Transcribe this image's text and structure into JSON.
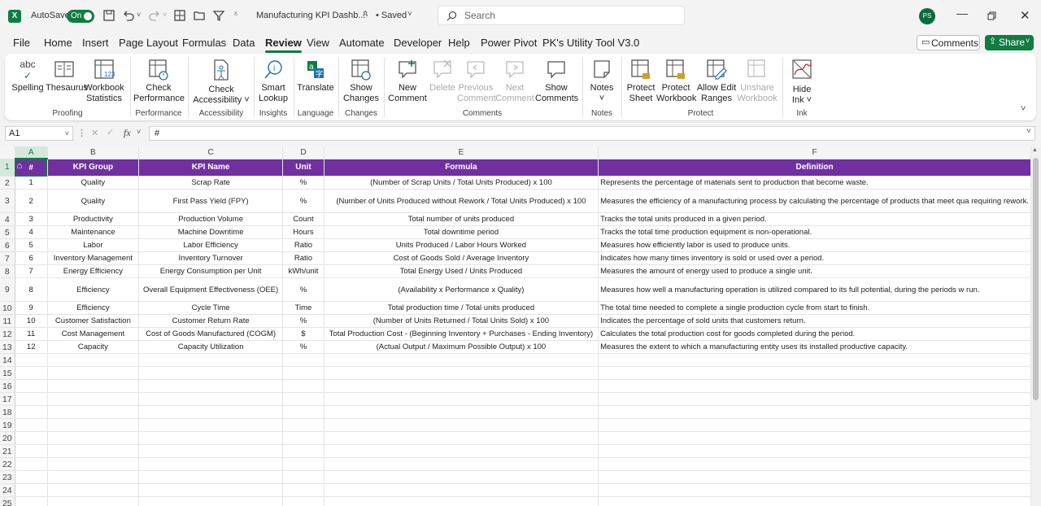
{
  "titlebar": {
    "autosave_label": "AutoSave",
    "autosave_state": "On",
    "doc_title": "Manufacturing KPI Dashb...",
    "saved_status": "• Saved",
    "search_placeholder": "Search",
    "avatar_initials": "PS"
  },
  "menu": {
    "tabs": [
      "File",
      "Home",
      "Insert",
      "Page Layout",
      "Formulas",
      "Data",
      "Review",
      "View",
      "Automate",
      "Developer",
      "Help",
      "Power Pivot",
      "PK's Utility Tool V3.0"
    ],
    "active": "Review",
    "comments_label": "Comments",
    "share_label": "Share"
  },
  "ribbon": {
    "spelling": "Spelling",
    "thesaurus": "Thesaurus",
    "workbook": "Workbook",
    "statistics": "Statistics",
    "check": "Check",
    "performance": "Performance",
    "accessibility": "Accessibility ˅",
    "smart": "Smart",
    "lookup": "Lookup",
    "translate": "Translate",
    "show": "Show",
    "changes": "Changes",
    "new": "New",
    "comment": "Comment",
    "delete": "Delete",
    "previous": "Previous",
    "next": "Next",
    "comments": "Comments",
    "notes": "Notes",
    "notes_caret": "˅",
    "protect": "Protect",
    "sheet": "Sheet",
    "allow_edit": "Allow Edit",
    "ranges": "Ranges",
    "unshare": "Unshare",
    "hide": "Hide",
    "ink": "Ink ˅",
    "groups": {
      "proofing": "Proofing",
      "performance": "Performance",
      "accessibility": "Accessibility",
      "insights": "Insights",
      "language": "Language",
      "changes": "Changes",
      "comments": "Comments",
      "notes": "Notes",
      "protect": "Protect",
      "ink": "Ink"
    }
  },
  "formula_bar": {
    "cell_ref": "A1",
    "fx": "fx",
    "content": "#"
  },
  "sheet": {
    "columns": [
      "A",
      "B",
      "C",
      "D",
      "E",
      "F"
    ],
    "headers": [
      "#",
      "KPI Group",
      "KPI Name",
      "Unit",
      "Formula",
      "Definition"
    ],
    "rows": [
      [
        "1",
        "Quality",
        "Scrap Rate",
        "%",
        "(Number of Scrap Units / Total Units Produced) x 100",
        "Represents the percentage of materials sent to production that become waste."
      ],
      [
        "2",
        "Quality",
        "First Pass Yield (FPY)",
        "%",
        "(Number of Units Produced without Rework / Total Units Produced) x 100",
        "Measures the efficiency of a manufacturing process by calculating the percentage of products that meet qua requiring rework."
      ],
      [
        "3",
        "Productivity",
        "Production Volume",
        "Count",
        "Total number of units produced",
        "Tracks the total units produced in a given period."
      ],
      [
        "4",
        "Maintenance",
        "Machine Downtime",
        "Hours",
        "Total downtime period",
        "Tracks the total time production equipment is non-operational."
      ],
      [
        "5",
        "Labor",
        "Labor Efficiency",
        "Ratio",
        "Units Produced / Labor Hours Worked",
        "Measures how efficiently labor is used to produce units."
      ],
      [
        "6",
        "Inventory Management",
        "Inventory Turnover",
        "Ratio",
        "Cost of Goods Sold / Average Inventory",
        "Indicates how many times inventory is sold or used over a period."
      ],
      [
        "7",
        "Energy Efficiency",
        "Energy Consumption per Unit",
        "kWh/unit",
        "Total Energy Used / Units Produced",
        "Measures the amount of energy used to produce a single unit."
      ],
      [
        "8",
        "Efficiency",
        "Overall Equipment Effectiveness (OEE)",
        "%",
        "(Availability x Performance x Quality)",
        "Measures how well a manufacturing operation is utilized compared to its full potential, during the periods w run."
      ],
      [
        "9",
        "Efficiency",
        "Cycle Time",
        "Time",
        "Total production time / Total units produced",
        "The total time needed to complete a single production cycle from start to finish."
      ],
      [
        "10",
        "Customer Satisfaction",
        "Customer Return Rate",
        "%",
        "(Number of Units Returned / Total Units Sold) x 100",
        "Indicates the percentage of sold units that customers return."
      ],
      [
        "11",
        "Cost Management",
        "Cost of Goods Manufactured (COGM)",
        "$",
        "Total Production Cost - (Beginning Inventory + Purchases - Ending Inventory)",
        "Calculates the total production cost for goods completed during the period."
      ],
      [
        "12",
        "Capacity",
        "Capacity Utilization",
        "%",
        "(Actual Output / Maximum Possible Output) x 100",
        "Measures the extent to which a manufacturing entity uses its installed productive capacity."
      ]
    ],
    "row_numbers": [
      "1",
      "2",
      "3",
      "4",
      "5",
      "6",
      "7",
      "8",
      "9",
      "10",
      "11",
      "12",
      "13",
      "14",
      "15",
      "16",
      "17",
      "18",
      "19",
      "20",
      "21",
      "22",
      "23",
      "24",
      "25"
    ]
  },
  "colors": {
    "excel_green": "#107c41",
    "header_purple": "#7030a0"
  }
}
